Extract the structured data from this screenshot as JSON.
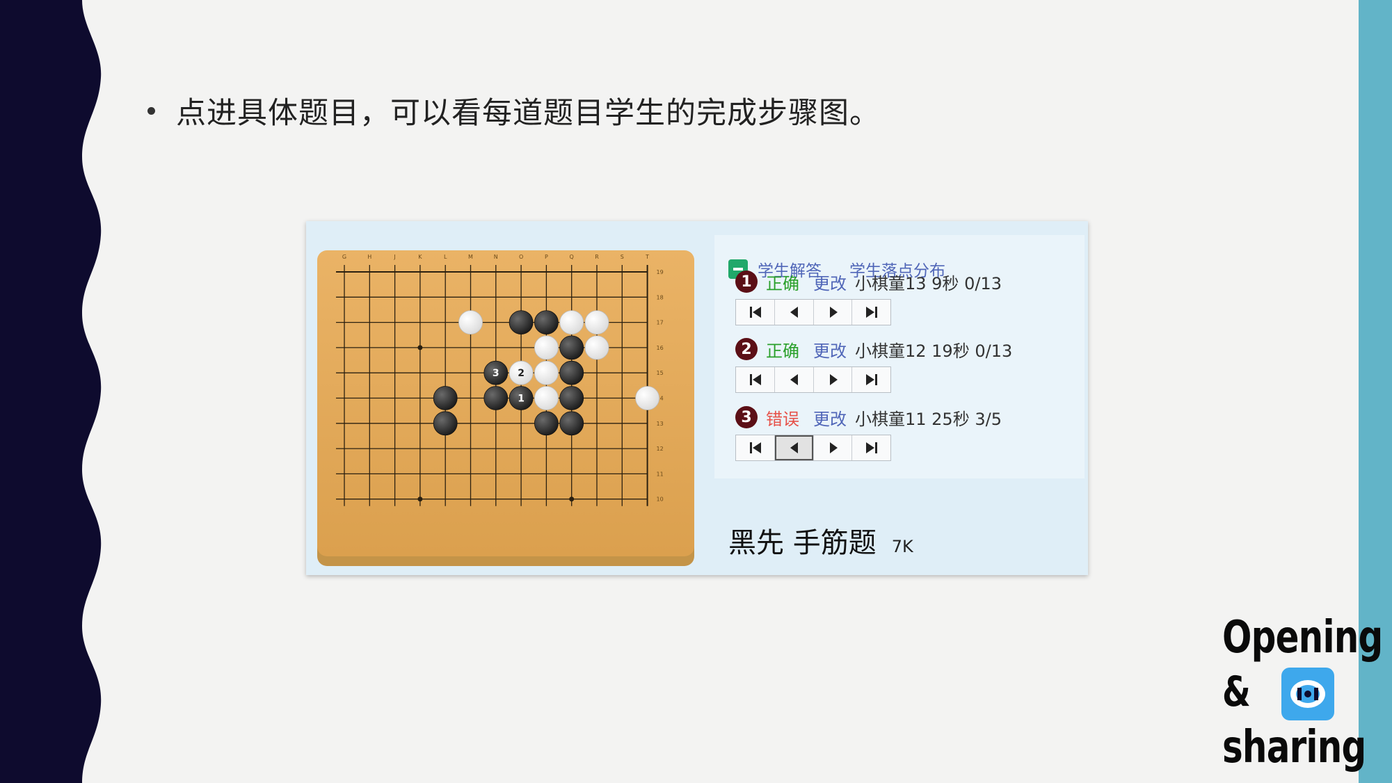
{
  "slide": {
    "bullet": "点进具体题目，可以看每道题目学生的完成步骤图。"
  },
  "board": {
    "columns": [
      "G",
      "H",
      "J",
      "K",
      "L",
      "M",
      "N",
      "O",
      "P",
      "Q",
      "R",
      "S",
      "T"
    ],
    "rows": [
      "19",
      "18",
      "17",
      "16",
      "15",
      "14",
      "13",
      "12",
      "11",
      "10"
    ],
    "black_stones": [
      [
        7,
        2
      ],
      [
        8,
        2
      ],
      [
        9,
        3
      ],
      [
        9,
        4
      ],
      [
        9,
        5
      ],
      [
        6,
        5
      ],
      [
        4,
        5
      ],
      [
        4,
        6
      ],
      [
        8,
        6
      ],
      [
        9,
        6
      ]
    ],
    "white_stones": [
      [
        5,
        2
      ],
      [
        9,
        2
      ],
      [
        10,
        2
      ],
      [
        8,
        3
      ],
      [
        10,
        3
      ],
      [
        7,
        4
      ],
      [
        8,
        4
      ],
      [
        8,
        5
      ],
      [
        12,
        5
      ],
      [
        7,
        5
      ]
    ],
    "numbered_moves": [
      {
        "col": 7,
        "row": 5,
        "color": "black",
        "label": "1"
      },
      {
        "col": 7,
        "row": 4,
        "color": "white",
        "label": "2"
      },
      {
        "col": 6,
        "row": 4,
        "color": "black",
        "label": "3"
      }
    ],
    "star_points": [
      [
        3,
        3
      ],
      [
        3,
        9
      ],
      [
        9,
        9
      ]
    ]
  },
  "panel": {
    "tabs": [
      "学生解答",
      "学生落点分布"
    ],
    "entries": [
      {
        "num": "1",
        "status": "正确",
        "status_type": "ok",
        "action": "更改",
        "info": "小棋童13 9秒 0/13",
        "active_button": -1
      },
      {
        "num": "2",
        "status": "正确",
        "status_type": "ok",
        "action": "更改",
        "info": "小棋童12 19秒 0/13",
        "active_button": -1
      },
      {
        "num": "3",
        "status": "错误",
        "status_type": "bad",
        "action": "更改",
        "info": "小棋童11 25秒 3/5",
        "active_button": 1
      }
    ],
    "problem_title": "黑先 手筋题",
    "level": "7K"
  },
  "logo": {
    "line1": "Opening",
    "line2": "&",
    "line3": "sharing"
  },
  "colors": {
    "background": "#f3f3f2",
    "left_band": "#0e0b2e",
    "right_stripe": "#62b4c8",
    "board_wood": "#e2a652",
    "correct": "#2aa02a",
    "wrong": "#e6524a",
    "link": "#5066b8",
    "badge": "#5b0f16",
    "logo_blue": "#3ea8ec"
  }
}
